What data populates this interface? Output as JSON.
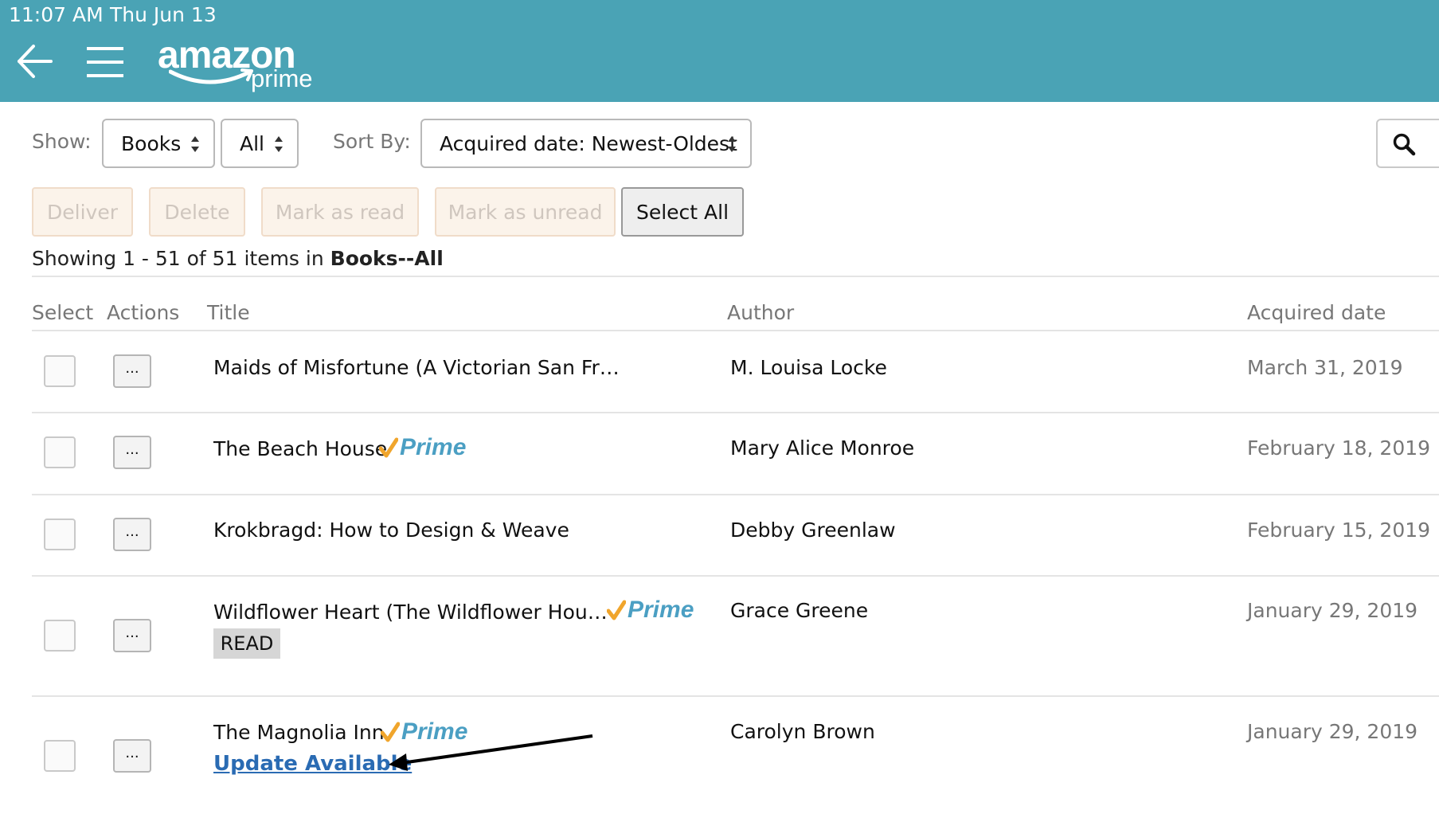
{
  "status_bar": {
    "time": "11:07 AM",
    "date": "Thu Jun 13"
  },
  "header": {
    "logo_word": "amazon",
    "logo_sub": "prime",
    "back_icon": "arrow-left-icon",
    "menu_icon": "hamburger-menu-icon",
    "header_color": "#4aa3b5"
  },
  "filters": {
    "show_label": "Show:",
    "show_value": "Books",
    "subset_value": "All",
    "sort_label": "Sort By:",
    "sort_value": "Acquired date: Newest-Oldest",
    "search_icon": "search-icon"
  },
  "actions": {
    "deliver": "Deliver",
    "delete": "Delete",
    "mark_read": "Mark as read",
    "mark_unread": "Mark as unread",
    "select_all": "Select All"
  },
  "summary": {
    "prefix": "Showing 1 - 51 of 51 items in ",
    "category": "Books--All"
  },
  "columns": {
    "select": "Select",
    "actions": "Actions",
    "title": "Title",
    "author": "Author",
    "acquired": "Acquired date"
  },
  "rows": [
    {
      "title": "Maids of Misfortune (A Victorian San Fr…",
      "author": "M. Louisa Locke",
      "date": "March 31, 2019",
      "actions_label": "..."
    },
    {
      "title": "The Beach House",
      "prime": "Prime",
      "author": "Mary Alice Monroe",
      "date": "February 18, 2019",
      "actions_label": "..."
    },
    {
      "title": "Krokbragd: How to Design & Weave",
      "author": "Debby Greenlaw",
      "date": "February 15, 2019",
      "actions_label": "..."
    },
    {
      "title": "Wildflower Heart (The Wildflower Hou…",
      "prime": "Prime",
      "badge": "READ",
      "author": "Grace Greene",
      "date": "January 29, 2019",
      "actions_label": "..."
    },
    {
      "title": "The Magnolia Inn",
      "prime": "Prime",
      "link": "Update Available",
      "author": "Carolyn Brown",
      "date": "January 29, 2019",
      "actions_label": "..."
    }
  ],
  "colors": {
    "prime_check": "#f0a52c",
    "prime_text": "#4b9fc3",
    "link": "#2a6bb3"
  }
}
